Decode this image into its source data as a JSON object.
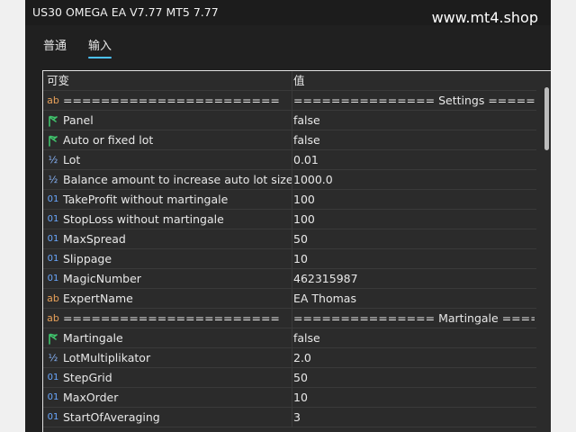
{
  "window": {
    "title": "US30 OMEGA EA V7.77 MT5 7.77",
    "watermark": "www.mt4.shop"
  },
  "tabs": [
    {
      "label": "普通",
      "active": false
    },
    {
      "label": "输入",
      "active": true
    }
  ],
  "table": {
    "headers": [
      "可变",
      "值"
    ],
    "rows": [
      {
        "icon": "ab",
        "name": "=======================",
        "value": "=============== Settings ======..."
      },
      {
        "icon": "flag",
        "name": "Panel",
        "value": "false"
      },
      {
        "icon": "flag",
        "name": "Auto or fixed lot",
        "value": "false"
      },
      {
        "icon": "half",
        "name": "Lot",
        "value": "0.01"
      },
      {
        "icon": "half",
        "name": "Balance amount to increase auto lot size",
        "value": "1000.0"
      },
      {
        "icon": "01",
        "name": "TakeProfit without martingale",
        "value": "100"
      },
      {
        "icon": "01",
        "name": "StopLoss without martingale",
        "value": "100"
      },
      {
        "icon": "01",
        "name": "MaxSpread",
        "value": "50"
      },
      {
        "icon": "01",
        "name": "Slippage",
        "value": "10"
      },
      {
        "icon": "01",
        "name": "MagicNumber",
        "value": "462315987"
      },
      {
        "icon": "ab",
        "name": "ExpertName",
        "value": "EA Thomas"
      },
      {
        "icon": "ab",
        "name": "=======================",
        "value": "=============== Martingale ====..."
      },
      {
        "icon": "flag",
        "name": "Martingale",
        "value": "false"
      },
      {
        "icon": "half",
        "name": "LotMultiplikator",
        "value": "2.0"
      },
      {
        "icon": "01",
        "name": "StepGrid",
        "value": "50"
      },
      {
        "icon": "01",
        "name": "MaxOrder",
        "value": "10"
      },
      {
        "icon": "01",
        "name": "StartOfAveraging",
        "value": "3"
      }
    ]
  },
  "icon_glyphs": {
    "ab": "ab",
    "half": "½",
    "01": "01"
  },
  "colors": {
    "background": "#202020",
    "accent": "#4cc2ff",
    "grid_bg": "#2b2b2b"
  }
}
